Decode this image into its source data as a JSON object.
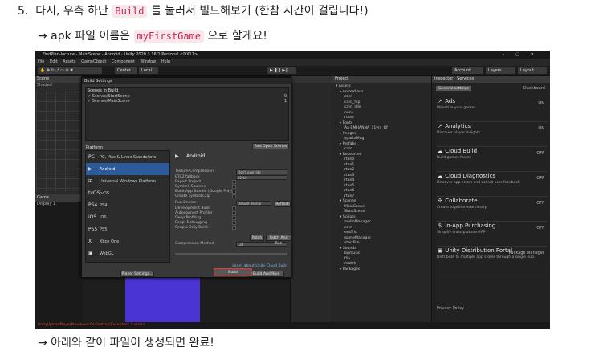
{
  "doc": {
    "step_number": "5.",
    "step_before": "다시, 우측 하단",
    "step_code": "Build",
    "step_after": "를 눌러서 빌드해보기 (한참 시간이 걸립니다!)",
    "apk_before": "→ apk 파일 이름은",
    "apk_code": "myFirstGame",
    "apk_after": "으로 할게요!",
    "next_line": "→ 아래와 같이 파일이 생성되면 완료!"
  },
  "unity": {
    "title": "FindPlan-lecture - MainScene - Android - Unity 2020.3.16f1 Personal <DX11>",
    "menu": [
      "File",
      "Edit",
      "Assets",
      "GameObject",
      "Component",
      "Window",
      "Help"
    ],
    "toolbar": {
      "center": "Center",
      "local": "Local",
      "account": "Account",
      "layers": "Layers",
      "layout": "Layout"
    },
    "panes": {
      "scene": "Scene",
      "game": "Game",
      "display": "Display 1",
      "project": "Project",
      "inspector": "Inspector",
      "services": "Services",
      "shaded": "Shaded"
    },
    "build": {
      "title": "Build Settings",
      "scenes_label": "Scenes In Build",
      "scenes": [
        {
          "name": "Scenes/StartScene",
          "idx": "0"
        },
        {
          "name": "Scenes/MainScene",
          "idx": "1"
        }
      ],
      "add_open": "Add Open Scenes",
      "platform_label": "Platform",
      "platforms": [
        {
          "icon": "PC",
          "label": "PC, Mac & Linux Standalone"
        },
        {
          "icon": "▶",
          "label": "Android"
        },
        {
          "icon": "⊞",
          "label": "Universal Windows Platform"
        },
        {
          "icon": "tvOS",
          "label": "tvOS"
        },
        {
          "icon": "PS4",
          "label": "PS4"
        },
        {
          "icon": "iOS",
          "label": "iOS"
        },
        {
          "icon": "PS5",
          "label": "PS5"
        },
        {
          "icon": "X",
          "label": "Xbox One"
        },
        {
          "icon": "▣",
          "label": "WebGL"
        }
      ],
      "selected_platform": "Android",
      "settings": [
        {
          "label": "Texture Compression",
          "value": "Don't override"
        },
        {
          "label": "ETC2 fallback",
          "value": "32-bit"
        },
        {
          "label": "Export Project",
          "value": ""
        },
        {
          "label": "Symlink Sources",
          "value": ""
        },
        {
          "label": "Build App Bundle (Google Play)",
          "value": ""
        },
        {
          "label": "Create symbols.zip",
          "value": ""
        },
        {
          "label": "Run Device",
          "value": "Default device"
        },
        {
          "label": "Development Build",
          "value": ""
        },
        {
          "label": "Autoconnect Profiler",
          "value": ""
        },
        {
          "label": "Deep Profiling",
          "value": ""
        },
        {
          "label": "Script Debugging",
          "value": ""
        },
        {
          "label": "Scripts Only Build",
          "value": ""
        },
        {
          "label": "Compression Method",
          "value": "LZ4"
        }
      ],
      "refresh": "Refresh",
      "patch": "Patch",
      "patch_run": "Patch And Run",
      "cloud_link": "Learn about Unity Cloud Build",
      "player_settings": "Player Settings...",
      "build_btn": "Build",
      "build_run": "Build And Run"
    },
    "project_items": [
      "▾ Assets",
      "▸ Animations",
      "card",
      "card_flip",
      "card_idle",
      "nanv",
      "rtans",
      "▸ Fonts",
      "Aa BMHANNA_11yrs_ttf",
      "▸ Images",
      "spartaMug",
      "▸ Prefabs",
      "card",
      "▾ Resources",
      "rtan0",
      "rtan1",
      "rtan2",
      "rtan3",
      "rtan4",
      "rtan5",
      "rtan6",
      "rtan7",
      "▾ Scenes",
      "MainScene",
      "StartScene",
      "▾ Scripts",
      "audioManager",
      "card",
      "endTxt",
      "gameManager",
      "startBtn",
      "▾ Sounds",
      "bgmusic",
      "flip",
      "match",
      "▸ Packages"
    ],
    "services": {
      "general": "General settings",
      "dashboard": "Dashboard",
      "items": [
        {
          "icon": "↗",
          "name": "Ads",
          "desc": "Monetize your games",
          "state": "ON"
        },
        {
          "icon": "↗",
          "name": "Analytics",
          "desc": "Discover player insights",
          "state": "ON"
        },
        {
          "icon": "☁",
          "name": "Cloud Build",
          "desc": "Build games faster",
          "state": "OFF"
        },
        {
          "icon": "☁",
          "name": "Cloud Diagnostics",
          "desc": "Discover app errors and collect user feedback",
          "state": "OFF"
        },
        {
          "icon": "✣",
          "name": "Collaborate",
          "desc": "Create together seamlessly",
          "state": "OFF"
        },
        {
          "icon": "$",
          "name": "In-App Purchasing",
          "desc": "Simplify cross-platform IAP",
          "state": "OFF"
        },
        {
          "icon": "▣",
          "name": "Unity Distribution Portal",
          "desc": "Distribute to multiple app stores through a single hub.",
          "state": "Package Manager"
        }
      ],
      "privacy": "Privacy Policy"
    },
    "status": "UnityUploadPlayerPreviewer:OnDestroy(Exception: 2 errors"
  }
}
